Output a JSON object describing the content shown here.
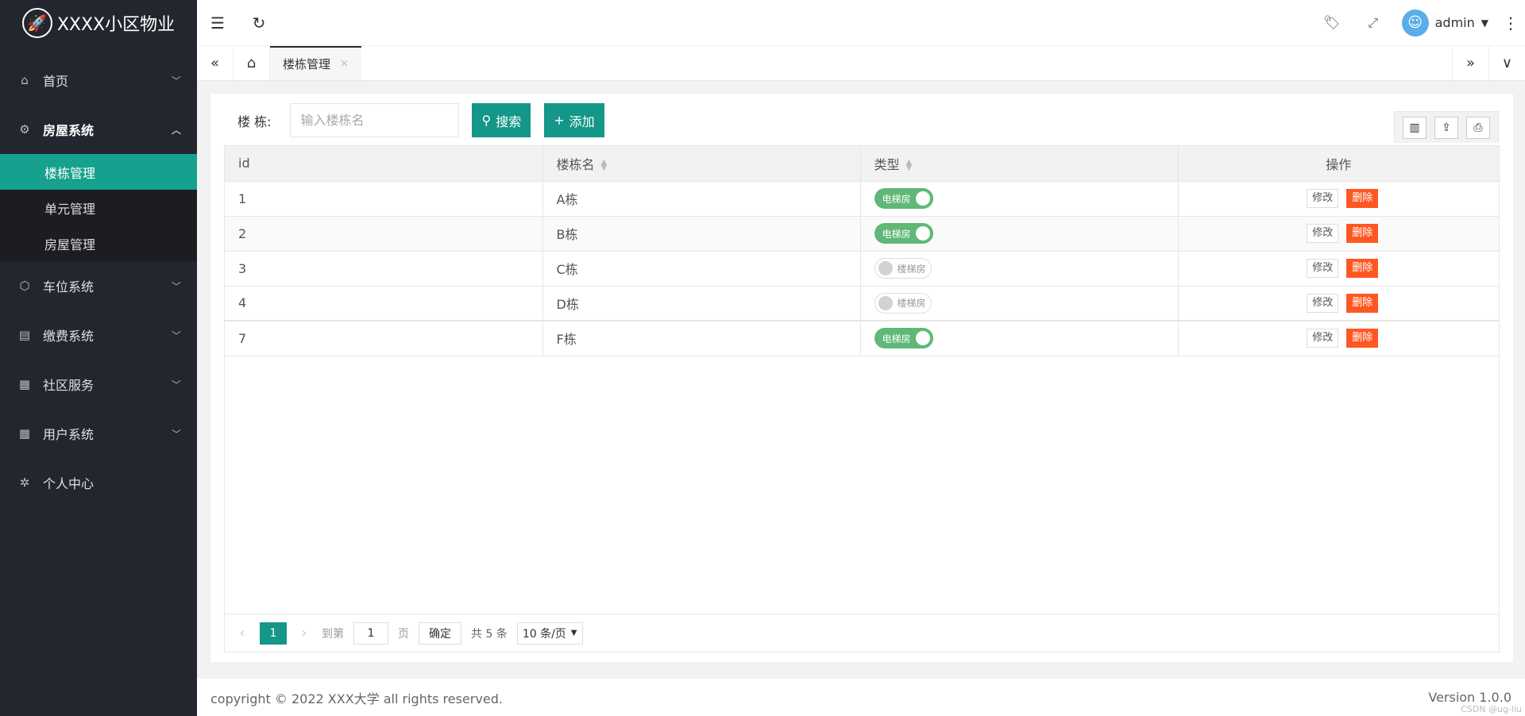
{
  "sidebar": {
    "logo_text": "XXXX小区物业",
    "menu": [
      {
        "label": "首页",
        "icon": "home-icon",
        "chev": "﹀"
      },
      {
        "label": "房屋系统",
        "icon": "gear-icon",
        "chev": "︿"
      },
      {
        "label": "车位系统",
        "icon": "cube-icon",
        "chev": "﹀"
      },
      {
        "label": "缴费系统",
        "icon": "bill-icon",
        "chev": "﹀"
      },
      {
        "label": "社区服务",
        "icon": "apps-icon",
        "chev": "﹀"
      },
      {
        "label": "用户系统",
        "icon": "apps-icon",
        "chev": "﹀"
      },
      {
        "label": "个人中心",
        "icon": "user-center-icon"
      }
    ],
    "submenu": [
      "楼栋管理",
      "单元管理",
      "房屋管理"
    ]
  },
  "header": {
    "username": "admin"
  },
  "tabs": {
    "active_tab": "楼栋管理",
    "close": "×"
  },
  "search": {
    "label": "楼 栋:",
    "placeholder": "输入楼栋名",
    "search_button": "搜索",
    "add_button": "添加"
  },
  "table": {
    "columns": [
      "id",
      "楼栋名",
      "类型",
      "操作"
    ],
    "rows": [
      {
        "id": "1",
        "name": "A栋",
        "type": "电梯房",
        "type_on": true
      },
      {
        "id": "2",
        "name": "B栋",
        "type": "电梯房",
        "type_on": true
      },
      {
        "id": "3",
        "name": "C栋",
        "type": "楼梯房",
        "type_on": false
      },
      {
        "id": "4",
        "name": "D栋",
        "type": "楼梯房",
        "type_on": false
      },
      {
        "id": "7",
        "name": "F栋",
        "type": "电梯房",
        "type_on": true
      }
    ],
    "edit_label": "修改",
    "delete_label": "删除"
  },
  "pager": {
    "current_page": "1",
    "goto_label": "到第",
    "goto_value": "1",
    "page_unit": "页",
    "confirm": "确定",
    "total": "共 5 条",
    "page_size": "10 条/页"
  },
  "footer": {
    "copyright": "copyright © 2022 XXX大学 all rights reserved.",
    "version": "Version 1.0.0",
    "watermark": "CSDN @ug-liu"
  },
  "colors": {
    "accent": "#149688",
    "sidebar_bg": "#23262e",
    "switch_on": "#5fb878",
    "danger": "#ff5722"
  }
}
